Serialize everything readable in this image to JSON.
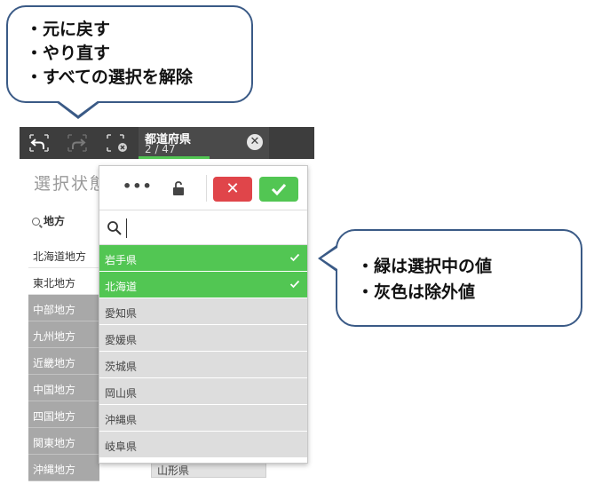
{
  "callouts": {
    "top": [
      "・元に戻す",
      "・やり直す",
      "・すべての選択を解除"
    ],
    "right": [
      "・緑は選択中の値",
      "・灰色は除外値"
    ]
  },
  "toolbar": {
    "field_title": "都道府県",
    "field_count": "2 / 47",
    "close_glyph": "✕",
    "icons": [
      "undo-icon",
      "redo-icon",
      "clear-selections-icon",
      "close-icon"
    ]
  },
  "background": {
    "title": "選択状態",
    "search_label": "地方",
    "list": [
      {
        "label": "北海道地方",
        "state": "possible"
      },
      {
        "label": "東北地方",
        "state": "possible"
      },
      {
        "label": "中部地方",
        "state": "excluded"
      },
      {
        "label": "九州地方",
        "state": "excluded"
      },
      {
        "label": "近畿地方",
        "state": "excluded"
      },
      {
        "label": "中国地方",
        "state": "excluded"
      },
      {
        "label": "四国地方",
        "state": "excluded"
      },
      {
        "label": "関東地方",
        "state": "excluded"
      },
      {
        "label": "沖縄地方",
        "state": "excluded"
      }
    ],
    "extra_text": "山形県"
  },
  "dropdown": {
    "more_label": "•••",
    "cancel_glyph": "✕",
    "search_value": "",
    "items": [
      {
        "label": "岩手県",
        "state": "selected"
      },
      {
        "label": "北海道",
        "state": "selected"
      },
      {
        "label": "愛知県",
        "state": "excluded"
      },
      {
        "label": "愛媛県",
        "state": "excluded"
      },
      {
        "label": "茨城県",
        "state": "excluded"
      },
      {
        "label": "岡山県",
        "state": "excluded"
      },
      {
        "label": "沖縄県",
        "state": "excluded"
      },
      {
        "label": "岐阜県",
        "state": "excluded"
      }
    ]
  },
  "colors": {
    "selected": "#52c653",
    "excluded": "#dddddd",
    "cancel": "#e0454a",
    "toolbar": "#3d3d3d",
    "callout_border": "#3a5a86"
  }
}
